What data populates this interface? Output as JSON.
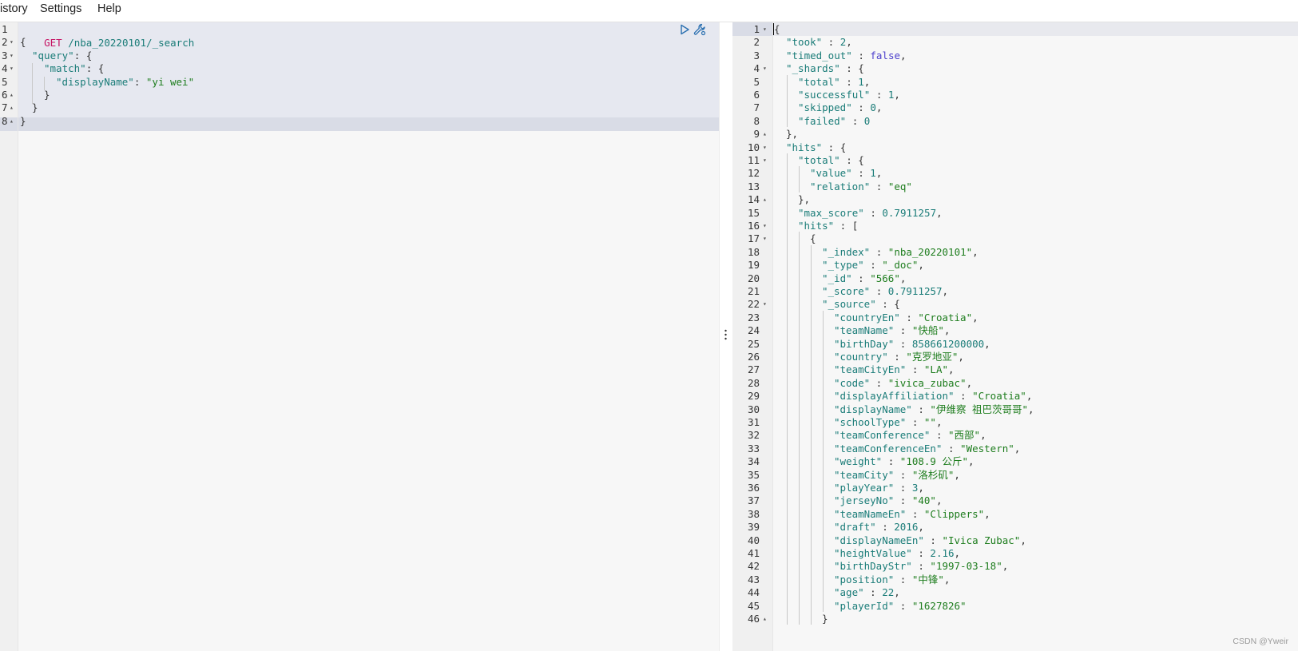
{
  "menu": {
    "history": "istory",
    "settings": "Settings",
    "help": "Help"
  },
  "request": {
    "line_numbers": [
      "1",
      "2",
      "3",
      "4",
      "5",
      "6",
      "7",
      "8"
    ],
    "method": "GET",
    "path": "/nba_20220101/_search",
    "lines": [
      {
        "indent": 0,
        "parts": [
          {
            "t": "{",
            "c": "p"
          }
        ]
      },
      {
        "indent": 1,
        "parts": [
          {
            "t": "\"query\"",
            "c": "k"
          },
          {
            "t": ": {",
            "c": "p"
          }
        ]
      },
      {
        "indent": 2,
        "parts": [
          {
            "t": "\"match\"",
            "c": "k"
          },
          {
            "t": ": {",
            "c": "p"
          }
        ]
      },
      {
        "indent": 3,
        "parts": [
          {
            "t": "\"displayName\"",
            "c": "k"
          },
          {
            "t": ": ",
            "c": "p"
          },
          {
            "t": "\"yi wei\"",
            "c": "s"
          }
        ]
      },
      {
        "indent": 2,
        "parts": [
          {
            "t": "}",
            "c": "p"
          }
        ]
      },
      {
        "indent": 1,
        "parts": [
          {
            "t": "}",
            "c": "p"
          }
        ]
      },
      {
        "indent": 0,
        "parts": [
          {
            "t": "}",
            "c": "p"
          }
        ]
      }
    ],
    "folds": {
      "2": "open",
      "3": "open",
      "4": "open",
      "6": "close",
      "7": "close",
      "8": "close"
    }
  },
  "response": {
    "lines": [
      {
        "n": "1",
        "f": "open",
        "indent": 0,
        "parts": [
          {
            "t": "{",
            "c": "p"
          }
        ]
      },
      {
        "n": "2",
        "indent": 1,
        "parts": [
          {
            "t": "\"took\"",
            "c": "k"
          },
          {
            "t": " : ",
            "c": "p"
          },
          {
            "t": "2",
            "c": "n"
          },
          {
            "t": ",",
            "c": "p"
          }
        ]
      },
      {
        "n": "3",
        "indent": 1,
        "parts": [
          {
            "t": "\"timed_out\"",
            "c": "k"
          },
          {
            "t": " : ",
            "c": "p"
          },
          {
            "t": "false",
            "c": "b"
          },
          {
            "t": ",",
            "c": "p"
          }
        ]
      },
      {
        "n": "4",
        "f": "open",
        "indent": 1,
        "parts": [
          {
            "t": "\"_shards\"",
            "c": "k"
          },
          {
            "t": " : {",
            "c": "p"
          }
        ]
      },
      {
        "n": "5",
        "indent": 2,
        "parts": [
          {
            "t": "\"total\"",
            "c": "k"
          },
          {
            "t": " : ",
            "c": "p"
          },
          {
            "t": "1",
            "c": "n"
          },
          {
            "t": ",",
            "c": "p"
          }
        ]
      },
      {
        "n": "6",
        "indent": 2,
        "parts": [
          {
            "t": "\"successful\"",
            "c": "k"
          },
          {
            "t": " : ",
            "c": "p"
          },
          {
            "t": "1",
            "c": "n"
          },
          {
            "t": ",",
            "c": "p"
          }
        ]
      },
      {
        "n": "7",
        "indent": 2,
        "parts": [
          {
            "t": "\"skipped\"",
            "c": "k"
          },
          {
            "t": " : ",
            "c": "p"
          },
          {
            "t": "0",
            "c": "n"
          },
          {
            "t": ",",
            "c": "p"
          }
        ]
      },
      {
        "n": "8",
        "indent": 2,
        "parts": [
          {
            "t": "\"failed\"",
            "c": "k"
          },
          {
            "t": " : ",
            "c": "p"
          },
          {
            "t": "0",
            "c": "n"
          }
        ]
      },
      {
        "n": "9",
        "f": "close",
        "indent": 1,
        "parts": [
          {
            "t": "},",
            "c": "p"
          }
        ]
      },
      {
        "n": "10",
        "f": "open",
        "indent": 1,
        "parts": [
          {
            "t": "\"hits\"",
            "c": "k"
          },
          {
            "t": " : {",
            "c": "p"
          }
        ]
      },
      {
        "n": "11",
        "f": "open",
        "indent": 2,
        "parts": [
          {
            "t": "\"total\"",
            "c": "k"
          },
          {
            "t": " : {",
            "c": "p"
          }
        ]
      },
      {
        "n": "12",
        "indent": 3,
        "parts": [
          {
            "t": "\"value\"",
            "c": "k"
          },
          {
            "t": " : ",
            "c": "p"
          },
          {
            "t": "1",
            "c": "n"
          },
          {
            "t": ",",
            "c": "p"
          }
        ]
      },
      {
        "n": "13",
        "indent": 3,
        "parts": [
          {
            "t": "\"relation\"",
            "c": "k"
          },
          {
            "t": " : ",
            "c": "p"
          },
          {
            "t": "\"eq\"",
            "c": "s"
          }
        ]
      },
      {
        "n": "14",
        "f": "close",
        "indent": 2,
        "parts": [
          {
            "t": "},",
            "c": "p"
          }
        ]
      },
      {
        "n": "15",
        "indent": 2,
        "parts": [
          {
            "t": "\"max_score\"",
            "c": "k"
          },
          {
            "t": " : ",
            "c": "p"
          },
          {
            "t": "0.7911257",
            "c": "n"
          },
          {
            "t": ",",
            "c": "p"
          }
        ]
      },
      {
        "n": "16",
        "f": "open",
        "indent": 2,
        "parts": [
          {
            "t": "\"hits\"",
            "c": "k"
          },
          {
            "t": " : [",
            "c": "p"
          }
        ]
      },
      {
        "n": "17",
        "f": "open",
        "indent": 3,
        "parts": [
          {
            "t": "{",
            "c": "p"
          }
        ]
      },
      {
        "n": "18",
        "indent": 4,
        "parts": [
          {
            "t": "\"_index\"",
            "c": "k"
          },
          {
            "t": " : ",
            "c": "p"
          },
          {
            "t": "\"nba_20220101\"",
            "c": "s"
          },
          {
            "t": ",",
            "c": "p"
          }
        ]
      },
      {
        "n": "19",
        "indent": 4,
        "parts": [
          {
            "t": "\"_type\"",
            "c": "k"
          },
          {
            "t": " : ",
            "c": "p"
          },
          {
            "t": "\"_doc\"",
            "c": "s"
          },
          {
            "t": ",",
            "c": "p"
          }
        ]
      },
      {
        "n": "20",
        "indent": 4,
        "parts": [
          {
            "t": "\"_id\"",
            "c": "k"
          },
          {
            "t": " : ",
            "c": "p"
          },
          {
            "t": "\"566\"",
            "c": "s"
          },
          {
            "t": ",",
            "c": "p"
          }
        ]
      },
      {
        "n": "21",
        "indent": 4,
        "parts": [
          {
            "t": "\"_score\"",
            "c": "k"
          },
          {
            "t": " : ",
            "c": "p"
          },
          {
            "t": "0.7911257",
            "c": "n"
          },
          {
            "t": ",",
            "c": "p"
          }
        ]
      },
      {
        "n": "22",
        "f": "open",
        "indent": 4,
        "parts": [
          {
            "t": "\"_source\"",
            "c": "k"
          },
          {
            "t": " : {",
            "c": "p"
          }
        ]
      },
      {
        "n": "23",
        "indent": 5,
        "parts": [
          {
            "t": "\"countryEn\"",
            "c": "k"
          },
          {
            "t": " : ",
            "c": "p"
          },
          {
            "t": "\"Croatia\"",
            "c": "s"
          },
          {
            "t": ",",
            "c": "p"
          }
        ]
      },
      {
        "n": "24",
        "indent": 5,
        "parts": [
          {
            "t": "\"teamName\"",
            "c": "k"
          },
          {
            "t": " : ",
            "c": "p"
          },
          {
            "t": "\"快船\"",
            "c": "s"
          },
          {
            "t": ",",
            "c": "p"
          }
        ]
      },
      {
        "n": "25",
        "indent": 5,
        "parts": [
          {
            "t": "\"birthDay\"",
            "c": "k"
          },
          {
            "t": " : ",
            "c": "p"
          },
          {
            "t": "858661200000",
            "c": "n"
          },
          {
            "t": ",",
            "c": "p"
          }
        ]
      },
      {
        "n": "26",
        "indent": 5,
        "parts": [
          {
            "t": "\"country\"",
            "c": "k"
          },
          {
            "t": " : ",
            "c": "p"
          },
          {
            "t": "\"克罗地亚\"",
            "c": "s"
          },
          {
            "t": ",",
            "c": "p"
          }
        ]
      },
      {
        "n": "27",
        "indent": 5,
        "parts": [
          {
            "t": "\"teamCityEn\"",
            "c": "k"
          },
          {
            "t": " : ",
            "c": "p"
          },
          {
            "t": "\"LA\"",
            "c": "s"
          },
          {
            "t": ",",
            "c": "p"
          }
        ]
      },
      {
        "n": "28",
        "indent": 5,
        "parts": [
          {
            "t": "\"code\"",
            "c": "k"
          },
          {
            "t": " : ",
            "c": "p"
          },
          {
            "t": "\"ivica_zubac\"",
            "c": "s"
          },
          {
            "t": ",",
            "c": "p"
          }
        ]
      },
      {
        "n": "29",
        "indent": 5,
        "parts": [
          {
            "t": "\"displayAffiliation\"",
            "c": "k"
          },
          {
            "t": " : ",
            "c": "p"
          },
          {
            "t": "\"Croatia\"",
            "c": "s"
          },
          {
            "t": ",",
            "c": "p"
          }
        ]
      },
      {
        "n": "30",
        "indent": 5,
        "parts": [
          {
            "t": "\"displayName\"",
            "c": "k"
          },
          {
            "t": " : ",
            "c": "p"
          },
          {
            "t": "\"伊维察 祖巴茨哥哥\"",
            "c": "s"
          },
          {
            "t": ",",
            "c": "p"
          }
        ]
      },
      {
        "n": "31",
        "indent": 5,
        "parts": [
          {
            "t": "\"schoolType\"",
            "c": "k"
          },
          {
            "t": " : ",
            "c": "p"
          },
          {
            "t": "\"\"",
            "c": "s"
          },
          {
            "t": ",",
            "c": "p"
          }
        ]
      },
      {
        "n": "32",
        "indent": 5,
        "parts": [
          {
            "t": "\"teamConference\"",
            "c": "k"
          },
          {
            "t": " : ",
            "c": "p"
          },
          {
            "t": "\"西部\"",
            "c": "s"
          },
          {
            "t": ",",
            "c": "p"
          }
        ]
      },
      {
        "n": "33",
        "indent": 5,
        "parts": [
          {
            "t": "\"teamConferenceEn\"",
            "c": "k"
          },
          {
            "t": " : ",
            "c": "p"
          },
          {
            "t": "\"Western\"",
            "c": "s"
          },
          {
            "t": ",",
            "c": "p"
          }
        ]
      },
      {
        "n": "34",
        "indent": 5,
        "parts": [
          {
            "t": "\"weight\"",
            "c": "k"
          },
          {
            "t": " : ",
            "c": "p"
          },
          {
            "t": "\"108.9 公斤\"",
            "c": "s"
          },
          {
            "t": ",",
            "c": "p"
          }
        ]
      },
      {
        "n": "35",
        "indent": 5,
        "parts": [
          {
            "t": "\"teamCity\"",
            "c": "k"
          },
          {
            "t": " : ",
            "c": "p"
          },
          {
            "t": "\"洛杉矶\"",
            "c": "s"
          },
          {
            "t": ",",
            "c": "p"
          }
        ]
      },
      {
        "n": "36",
        "indent": 5,
        "parts": [
          {
            "t": "\"playYear\"",
            "c": "k"
          },
          {
            "t": " : ",
            "c": "p"
          },
          {
            "t": "3",
            "c": "n"
          },
          {
            "t": ",",
            "c": "p"
          }
        ]
      },
      {
        "n": "37",
        "indent": 5,
        "parts": [
          {
            "t": "\"jerseyNo\"",
            "c": "k"
          },
          {
            "t": " : ",
            "c": "p"
          },
          {
            "t": "\"40\"",
            "c": "s"
          },
          {
            "t": ",",
            "c": "p"
          }
        ]
      },
      {
        "n": "38",
        "indent": 5,
        "parts": [
          {
            "t": "\"teamNameEn\"",
            "c": "k"
          },
          {
            "t": " : ",
            "c": "p"
          },
          {
            "t": "\"Clippers\"",
            "c": "s"
          },
          {
            "t": ",",
            "c": "p"
          }
        ]
      },
      {
        "n": "39",
        "indent": 5,
        "parts": [
          {
            "t": "\"draft\"",
            "c": "k"
          },
          {
            "t": " : ",
            "c": "p"
          },
          {
            "t": "2016",
            "c": "n"
          },
          {
            "t": ",",
            "c": "p"
          }
        ]
      },
      {
        "n": "40",
        "indent": 5,
        "parts": [
          {
            "t": "\"displayNameEn\"",
            "c": "k"
          },
          {
            "t": " : ",
            "c": "p"
          },
          {
            "t": "\"Ivica Zubac\"",
            "c": "s"
          },
          {
            "t": ",",
            "c": "p"
          }
        ]
      },
      {
        "n": "41",
        "indent": 5,
        "parts": [
          {
            "t": "\"heightValue\"",
            "c": "k"
          },
          {
            "t": " : ",
            "c": "p"
          },
          {
            "t": "2.16",
            "c": "n"
          },
          {
            "t": ",",
            "c": "p"
          }
        ]
      },
      {
        "n": "42",
        "indent": 5,
        "parts": [
          {
            "t": "\"birthDayStr\"",
            "c": "k"
          },
          {
            "t": " : ",
            "c": "p"
          },
          {
            "t": "\"1997-03-18\"",
            "c": "s"
          },
          {
            "t": ",",
            "c": "p"
          }
        ]
      },
      {
        "n": "43",
        "indent": 5,
        "parts": [
          {
            "t": "\"position\"",
            "c": "k"
          },
          {
            "t": " : ",
            "c": "p"
          },
          {
            "t": "\"中锋\"",
            "c": "s"
          },
          {
            "t": ",",
            "c": "p"
          }
        ]
      },
      {
        "n": "44",
        "indent": 5,
        "parts": [
          {
            "t": "\"age\"",
            "c": "k"
          },
          {
            "t": " : ",
            "c": "p"
          },
          {
            "t": "22",
            "c": "n"
          },
          {
            "t": ",",
            "c": "p"
          }
        ]
      },
      {
        "n": "45",
        "indent": 5,
        "parts": [
          {
            "t": "\"playerId\"",
            "c": "k"
          },
          {
            "t": " : ",
            "c": "p"
          },
          {
            "t": "\"1627826\"",
            "c": "s"
          }
        ]
      },
      {
        "n": "46",
        "f": "close",
        "indent": 4,
        "parts": [
          {
            "t": "}",
            "c": "p"
          }
        ]
      }
    ]
  },
  "watermark": "CSDN @Yweir",
  "icons": {
    "run": "play-icon",
    "settings": "wrench-icon",
    "splitter": "vertical-dots-icon"
  },
  "colors": {
    "key": "#1a7c78",
    "string": "#1e7d1e",
    "method": "#c51162",
    "boolean": "#4d40cc"
  }
}
